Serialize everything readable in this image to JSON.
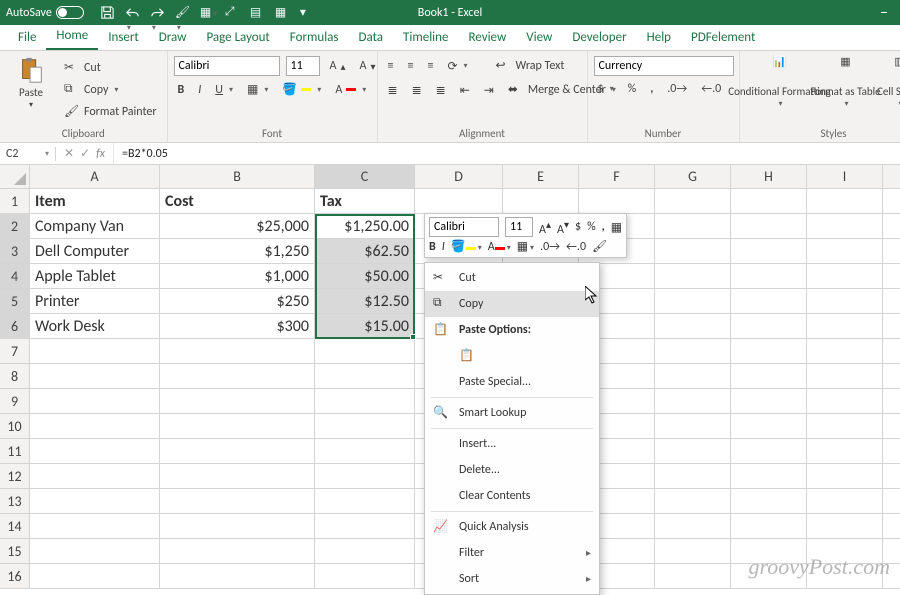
{
  "titlebar": {
    "autosave_label": "AutoSave",
    "autosave_state": "Off",
    "title": "Book1 - Excel"
  },
  "ribbon_tabs": [
    "File",
    "Home",
    "Insert",
    "Draw",
    "Page Layout",
    "Formulas",
    "Data",
    "Timeline",
    "Review",
    "View",
    "Developer",
    "Help",
    "PDFelement"
  ],
  "active_tab": "Home",
  "clipboard": {
    "paste": "Paste",
    "cut": "Cut",
    "copy": "Copy",
    "format_painter": "Format Painter",
    "group_label": "Clipboard"
  },
  "font": {
    "name": "Calibri",
    "size": "11",
    "group_label": "Font"
  },
  "alignment": {
    "wrap": "Wrap Text",
    "merge": "Merge & Center",
    "group_label": "Alignment"
  },
  "number": {
    "format": "Currency",
    "group_label": "Number"
  },
  "styles": {
    "conditional": "Conditional Formatting",
    "format_table": "Format as Table",
    "cell_styles": "Cell Styles",
    "group_label": "Styles"
  },
  "name_box": "C2",
  "formula": "=B2*0.05",
  "columns": [
    "A",
    "B",
    "C",
    "D",
    "E",
    "F",
    "G",
    "H",
    "I"
  ],
  "data": {
    "headers": [
      "Item",
      "Cost",
      "Tax"
    ],
    "rows": [
      {
        "n": 2,
        "item": "Company Van",
        "cost": "$25,000",
        "tax": "$1,250.00"
      },
      {
        "n": 3,
        "item": "Dell Computer",
        "cost": "$1,250",
        "tax": "$62.50"
      },
      {
        "n": 4,
        "item": "Apple Tablet",
        "cost": "$1,000",
        "tax": "$50.00"
      },
      {
        "n": 5,
        "item": "Printer",
        "cost": "$250",
        "tax": "$12.50"
      },
      {
        "n": 6,
        "item": "Work Desk",
        "cost": "$300",
        "tax": "$15.00"
      }
    ]
  },
  "mini_toolbar": {
    "font": "Calibri",
    "size": "11"
  },
  "context_menu": {
    "cut": "Cut",
    "copy": "Copy",
    "paste_options": "Paste Options:",
    "paste_special": "Paste Special...",
    "smart_lookup": "Smart Lookup",
    "insert": "Insert...",
    "delete": "Delete...",
    "clear_contents": "Clear Contents",
    "quick_analysis": "Quick Analysis",
    "filter": "Filter",
    "sort": "Sort"
  },
  "watermark": "groovyPost.com"
}
